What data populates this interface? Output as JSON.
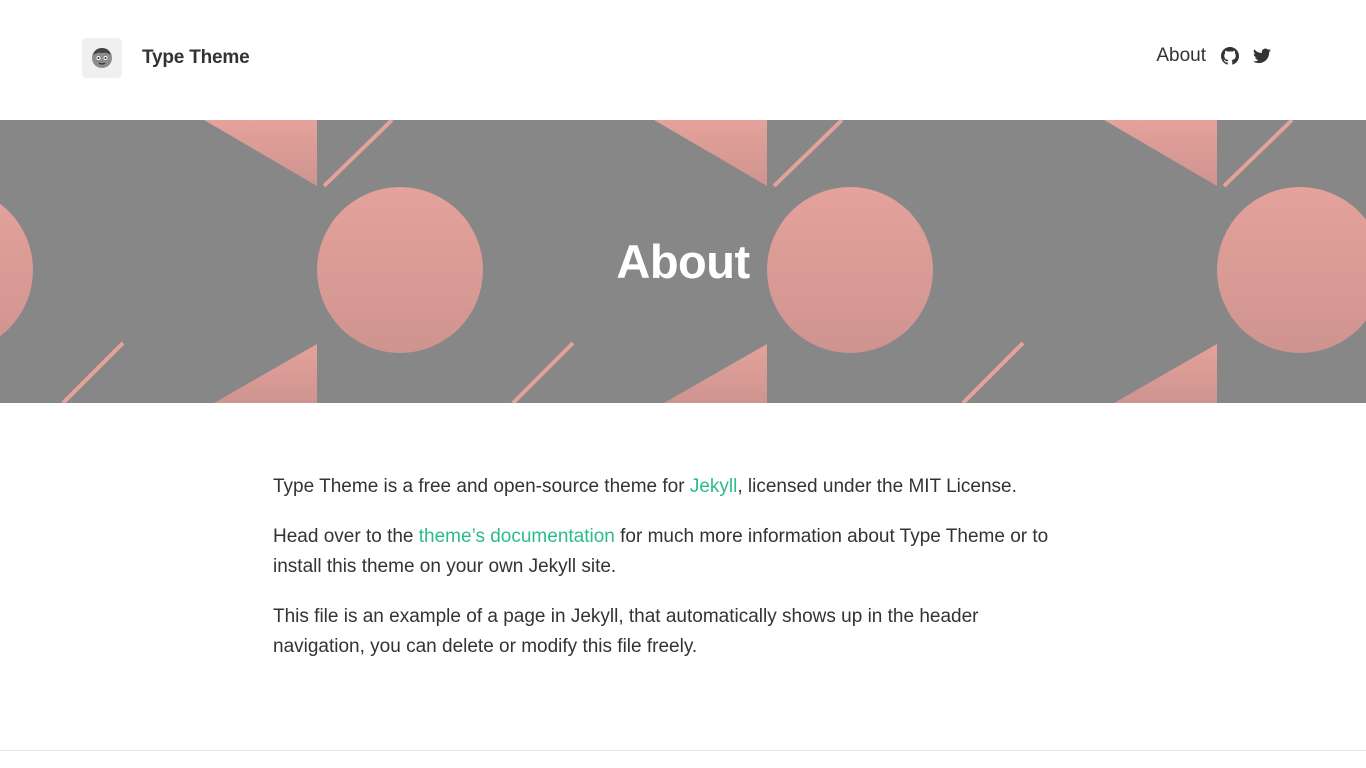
{
  "header": {
    "site_title": "Type Theme",
    "avatar_icon": "cartoon-face-avatar",
    "nav": {
      "about_label": "About",
      "github_icon": "github-icon",
      "twitter_icon": "twitter-icon"
    }
  },
  "hero": {
    "title": "About"
  },
  "content": {
    "p1_before": "Type Theme is a free and open-source theme for ",
    "p1_link": "Jekyll",
    "p1_after": ", licensed under the MIT License.",
    "p2_before": "Head over to the ",
    "p2_link": "theme’s documentation",
    "p2_after": " for much more information about Type Theme or to install this theme on your own Jekyll site.",
    "p3": "This file is an example of a page in Jekyll, that automatically shows up in the header navigation, you can delete or modify this file freely."
  },
  "colors": {
    "accent": "#2bbc8a",
    "hero_background": "#878787",
    "hero_shape": "#e3a29a",
    "text": "#333333"
  }
}
